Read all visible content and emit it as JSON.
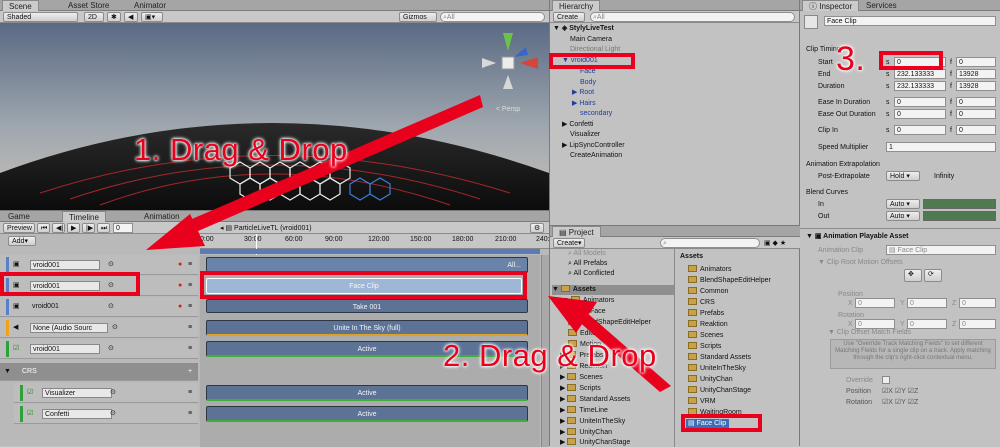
{
  "scene": {
    "tabs": [
      "Scene",
      "Asset Store",
      "Animator"
    ],
    "shading": "Shaded",
    "mode_2d": "2D",
    "gizmos": "Gizmos",
    "search_placeholder": "All",
    "persp": "< Persp"
  },
  "hierarchy": {
    "tab": "Hierarchy",
    "create": "Create",
    "search_placeholder": "All",
    "scene_name": "StylyLiveTest",
    "items": [
      "Main Camera",
      "Directional Light",
      "vroid001",
      "Face",
      "Body",
      "Root",
      "Hairs",
      "secondary",
      "Confetti",
      "Visualizer",
      "LipSyncController",
      "CreateAnimation"
    ]
  },
  "inspector": {
    "tabs": [
      "Inspector",
      "Services"
    ],
    "title": "Face Clip",
    "clip_timing": "Clip Timing",
    "start_label": "Start",
    "start_s": "0",
    "start_f": "0",
    "end_label": "End",
    "end_s": "232.133333",
    "end_f": "13928",
    "duration_label": "Duration",
    "duration_s": "232.133333",
    "duration_f": "13928",
    "ease_in_label": "Ease In Duration",
    "ease_in_s": "0",
    "ease_in_f": "0",
    "ease_out_label": "Ease Out Duration",
    "ease_out_s": "0",
    "ease_out_f": "0",
    "clip_in_label": "Clip In",
    "clip_in_s": "0",
    "clip_in_f": "0",
    "speed_label": "Speed Multiplier",
    "speed": "1",
    "extrap_header": "Animation Extrapolation",
    "post_extrap_label": "Post-Extrapolate",
    "post_extrap": "Hold",
    "infinity": "Infinity",
    "blend_header": "Blend Curves",
    "blend_in_label": "In",
    "blend_in": "Auto",
    "blend_out_label": "Out",
    "blend_out": "Auto",
    "playable_header": "Animation Playable Asset",
    "anim_clip_label": "Animation Clip",
    "anim_clip": "Face Clip",
    "root_offsets": "Clip Root Motion Offsets",
    "position_label": "Position",
    "rotation_label": "Rotation",
    "x": "X",
    "y": "Y",
    "z": "Z",
    "zero": "0",
    "match_fields": "Clip Offset Match Fields",
    "help": "Use \"Override Track Matching Fields\" to set different Matching Fields for a single clip on a track. Apply matching through the clip's right-click contextual menu.",
    "override_label": "Override",
    "pos_label2": "Position",
    "rot_label2": "Rotation"
  },
  "timeline": {
    "tabs": [
      "Game",
      "Timeline",
      "Animation"
    ],
    "preview": "Preview",
    "add": "Add",
    "asset_name": "ParticleLiveTL (vroid001)",
    "time_display": "0",
    "ruler": [
      "0:00",
      "30:00",
      "60:00",
      "90:00",
      "120:00",
      "150:00",
      "180:00",
      "210:00",
      "240:00"
    ],
    "tracks": [
      {
        "name": "vroid001",
        "color": "#5b7fc6"
      },
      {
        "name": "vroid001",
        "color": "#5b7fc6"
      },
      {
        "name": "vroid001",
        "color": "#5b7fc6"
      },
      {
        "name": "None (Audio Sourc",
        "color": "#f1a11a"
      },
      {
        "name": "vroid001",
        "color": "#2fa13a"
      }
    ],
    "group": "CRS",
    "group_tracks": [
      {
        "name": "Visualizer",
        "color": "#2fa13a"
      },
      {
        "name": "Confetti",
        "color": "#2fa13a"
      }
    ],
    "clips": [
      "Face Clip",
      "Take 001",
      "Unite In The Sky (full)",
      "Active",
      "Active",
      "Active"
    ],
    "top_clip": "All..."
  },
  "project": {
    "tab": "Project",
    "create": "Create",
    "favorites": [
      "All Models",
      "All Prefabs",
      "All Conflicted"
    ],
    "left_tree": [
      "Assets",
      "Animators",
      "Face",
      "BlendShapeEditHelper",
      "Editor",
      "Motion",
      "Prefabs",
      "Reaktion",
      "Scenes",
      "Scripts",
      "Standard Assets",
      "TimeLine",
      "UniteInTheSky",
      "UnityChan",
      "UnityChanStage"
    ],
    "breadcrumb": "Assets",
    "right_list": [
      "Animators",
      "BlendShapeEditHelper",
      "Common",
      "CRS",
      "Prefabs",
      "Reaktion",
      "Scenes",
      "Scripts",
      "Standard Assets",
      "UniteInTheSky",
      "UnityChan",
      "UnityChanStage",
      "VRM",
      "WaitingRoom",
      "Face Clip"
    ]
  },
  "annotations": {
    "step1": "1. Drag & Drop",
    "step2": "2. Drag & Drop",
    "step3": "3."
  },
  "colors": {
    "annotation_red": "#e8001c",
    "clip_blue": "#5d7396",
    "clip_selected": "#9fb7d6",
    "clip_green_bar": "#3fae3c"
  }
}
